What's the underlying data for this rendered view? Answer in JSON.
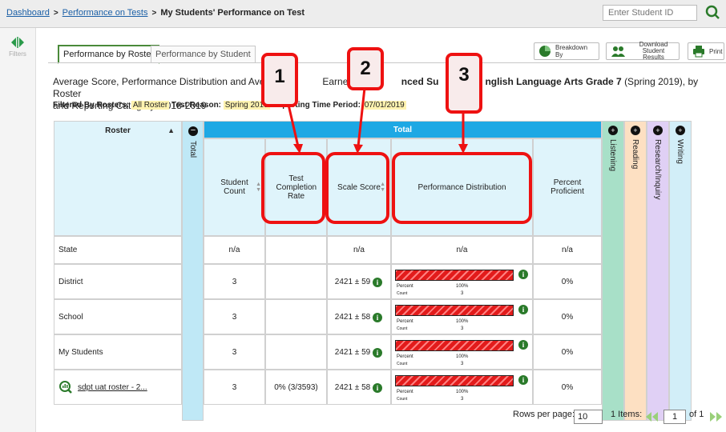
{
  "breadcrumb": {
    "dashboard": "Dashboard",
    "perf_on_tests": "Performance on Tests",
    "current": "My Students' Performance on Test"
  },
  "search": {
    "placeholder": "Enter Student ID"
  },
  "sidebar": {
    "filters_label": "Filters"
  },
  "tabs": [
    {
      "label": "Performance by Roster"
    },
    {
      "label": "Performance by Student"
    }
  ],
  "toolbar": {
    "breakdown": "Breakdown By",
    "download_line1": "Download",
    "download_line2": "Student Results",
    "print": "Print"
  },
  "heading": {
    "line1_a": "Average Score, Performance Distribution and Aver",
    "line1_b": "Earned on",
    "line1_c": "nced Su",
    "line1_d": "nglish Language Arts Grade 7",
    "line1_e": "(Spring 2019), by Roster",
    "line2": "and Reporting Category: 2018-2019"
  },
  "filters": {
    "rosters_label": "Filtered By Rosters:",
    "rosters_value": "All Roster",
    "reason_label": "Test Reason:",
    "reason_value": "Spring 2019",
    "period_label": "Reporting Time Period:",
    "period_value": "07/01/2019"
  },
  "table": {
    "roster_header": "Roster",
    "total_vertical": "Total",
    "total_header": "Total",
    "columns": [
      "Student Count",
      "Test Completion Rate",
      "Scale Score",
      "Performance Distribution",
      "Percent Proficient"
    ],
    "claims": [
      "Listening",
      "Reading",
      "Research/Inquiry",
      "Writing"
    ],
    "rows": [
      {
        "name": "State",
        "count": "n/a",
        "completion": "",
        "score": "n/a",
        "dist": "n/a",
        "prof": "n/a"
      },
      {
        "name": "District",
        "count": "3",
        "completion": "",
        "score": "2421 ± 59",
        "pct": "100%",
        "cnt": "3",
        "prof": "0%"
      },
      {
        "name": "School",
        "count": "3",
        "completion": "",
        "score": "2421 ± 58",
        "pct": "100%",
        "cnt": "3",
        "prof": "0%"
      },
      {
        "name": "My Students",
        "count": "3",
        "completion": "",
        "score": "2421 ± 59",
        "pct": "100%",
        "cnt": "3",
        "prof": "0%"
      },
      {
        "name": "sdpt uat roster - 2...",
        "count": "3",
        "completion": "0% (3/3593)",
        "score": "2421 ± 58",
        "pct": "100%",
        "cnt": "3",
        "prof": "0%"
      }
    ],
    "dist_percent_label": "Percent",
    "dist_count_label": "Count"
  },
  "callouts": [
    "1",
    "2",
    "3"
  ],
  "pagination": {
    "rows_per_page_label": "Rows per page:",
    "rows_per_page": "10",
    "items": "1 Items:",
    "page": "1",
    "of_pages": "of 1"
  },
  "colors": {
    "total_header": "#1da8e4",
    "listening": "#a8e0c8",
    "reading": "#fde0c2",
    "research": "#e0d0f5",
    "writing": "#d2eef8",
    "callout": "#ee1111",
    "bar": "#e21b1b"
  }
}
